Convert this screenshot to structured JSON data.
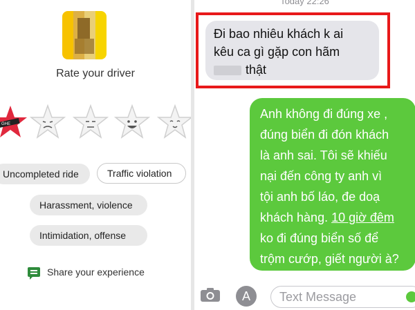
{
  "left": {
    "title": "Rate your driver",
    "chips": [
      "Uncompleted ride",
      "Traffic violation",
      "Harassment, violence",
      "Intimidation, offense"
    ],
    "share_label": "Share your experience",
    "rating_stars": 5,
    "selected_badge": "GHE",
    "colors": {
      "badge": "#e0283d",
      "star_fill": "#eeeeee",
      "accent": "#2e8b3b"
    }
  },
  "right": {
    "timestamp": "Today 22:26",
    "received": {
      "line1": "Đi bao nhiêu khách k ai",
      "line2": "kêu ca gì gặp con hãm",
      "line3": "thật"
    },
    "sent": {
      "lines": [
        "Anh không đi đúng xe ,",
        "đúng biển đi đón khách",
        "là anh sai. Tôi sẽ khiếu",
        "nại đến công ty anh vì",
        "tội anh bố láo, đe doạ",
        "khách hàng. ",
        "ko đi đúng biển số để",
        "trộm cướp, giết người à?"
      ],
      "underlined": "10 giờ đêm"
    },
    "input_placeholder": "Text Message",
    "colors": {
      "sent_bubble": "#5cc93d",
      "received_bubble": "#e5e5ea",
      "highlight_border": "#e8191a"
    }
  }
}
